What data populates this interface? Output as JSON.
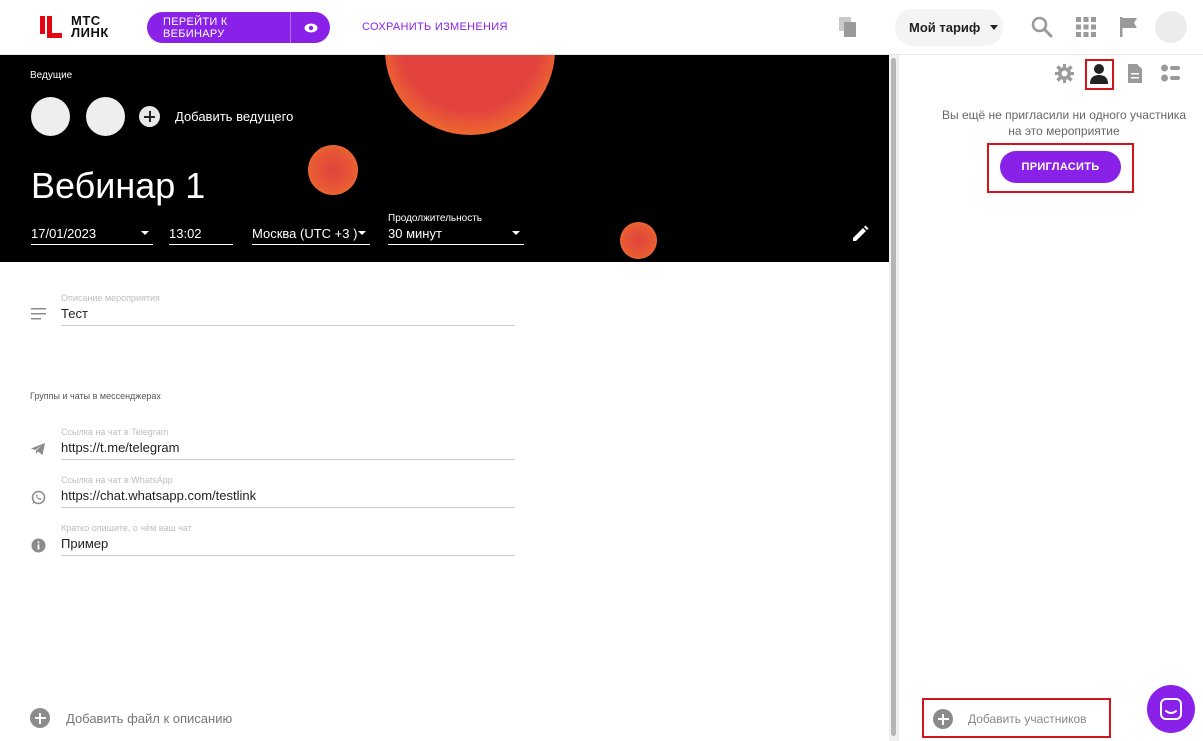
{
  "brand": {
    "line1": "МТС",
    "line2": "ЛИНК",
    "accent": "#8a21e8",
    "logo_red": "#e30611"
  },
  "topbar": {
    "go_to_webinar": "ПЕРЕЙТИ К ВЕБИНАРУ",
    "save_changes": "СОХРАНИТЬ ИЗМЕНЕНИЯ",
    "tariff": "Мой тариф",
    "icons": [
      "copy-icon",
      "search-icon",
      "apps-grid-icon",
      "flag-icon",
      "avatar"
    ]
  },
  "hero": {
    "hosts_title": "Ведущие",
    "add_host": "Добавить ведущего",
    "title": "Вебинар 1",
    "date": "17/01/2023",
    "time": "13:02",
    "timezone": "Москва (UTC +3 )",
    "duration_label": "Продолжительность",
    "duration": "30 минут"
  },
  "form": {
    "description": {
      "label": "Описание мероприятия",
      "value": "Тест"
    },
    "groups_title": "Группы и чаты в мессенджерах",
    "telegram": {
      "label": "Ссылка на чат в Telegram",
      "value": "https://t.me/telegram"
    },
    "whatsapp": {
      "label": "Ссылка на чат в WhatsApp",
      "value": "https://chat.whatsapp.com/testlink"
    },
    "chat_info": {
      "label": "Кратко опишите, о чём ваш чат",
      "value": "Пример"
    },
    "add_file": "Добавить файл к описанию"
  },
  "right_panel": {
    "tabs": [
      "settings-icon",
      "person-icon",
      "document-icon",
      "toggles-icon"
    ],
    "active_tab": "person-icon",
    "empty_message": "Вы ещё не пригласили ни одного участника на это мероприятие",
    "invite_button": "ПРИГЛАСИТЬ",
    "add_participants": "Добавить участников"
  }
}
